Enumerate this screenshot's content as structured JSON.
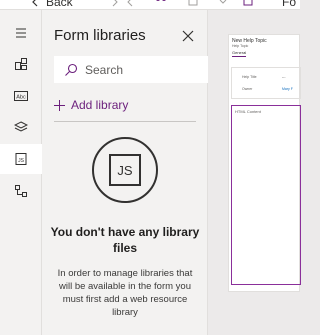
{
  "toolbar": {
    "back_label": "Back",
    "fo_label": "Fo"
  },
  "rail": {
    "items": [
      {
        "name": "hamburger-menu-icon"
      },
      {
        "name": "components-icon"
      },
      {
        "name": "text-field-icon"
      },
      {
        "name": "layers-icon"
      },
      {
        "name": "javascript-icon"
      },
      {
        "name": "tree-view-icon"
      }
    ]
  },
  "panel": {
    "title": "Form libraries",
    "search_placeholder": "Search",
    "add_library_label": "Add library",
    "empty_title": "You don't have any library files",
    "empty_description": "In order to manage libraries that will be available in the form you must first add a web resource library",
    "js_badge": "JS"
  },
  "form_preview": {
    "title": "New Help Topic",
    "subtitle": "Help Topic",
    "tab": "General",
    "fields": [
      {
        "label": "Help Title",
        "value": "---"
      },
      {
        "label": "Owner",
        "value": "Mary F"
      }
    ],
    "html_area_label": "HTML Content"
  },
  "colors": {
    "accent": "#6b1f7c",
    "rail_bg": "#f3f2f1",
    "canvas_bg": "#eceaea"
  }
}
